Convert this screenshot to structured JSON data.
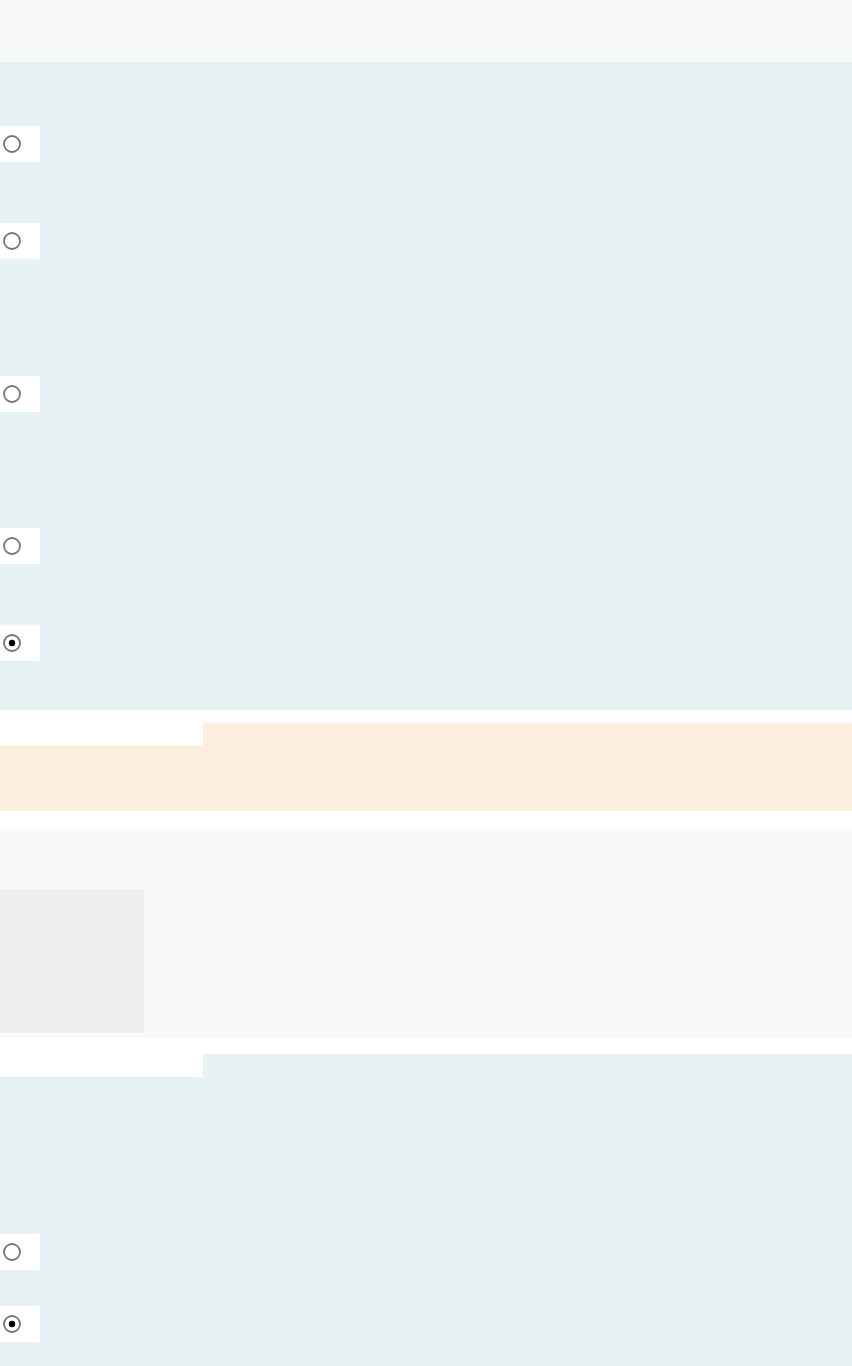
{
  "sections": [
    {
      "kind": "header"
    },
    {
      "kind": "question",
      "options": [
        {
          "selected": false
        },
        {
          "selected": false
        },
        {
          "selected": false
        },
        {
          "selected": false
        },
        {
          "selected": true
        }
      ]
    },
    {
      "kind": "feedback"
    },
    {
      "kind": "media"
    },
    {
      "kind": "question",
      "tabbed": true,
      "options": [
        {
          "selected": false
        },
        {
          "selected": true
        }
      ]
    }
  ]
}
